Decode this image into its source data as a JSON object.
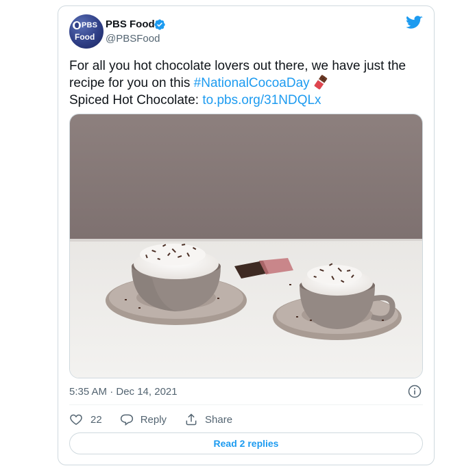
{
  "author": {
    "display_name": "PBS Food",
    "handle": "@PBSFood",
    "avatar_text_top": "PBS",
    "avatar_text_bottom": "Food",
    "verified": true
  },
  "tweet": {
    "text_part1": "For all you hot chocolate lovers out there, we have just the recipe for you on this ",
    "hashtag": "#NationalCocoaDay",
    "emoji_icon": "chocolate-bar-emoji",
    "line2_prefix": "Spiced Hot Chocolate: ",
    "link": "to.pbs.org/31NDQLx",
    "timestamp": "5:35 AM · Dec 14, 2021"
  },
  "media": {
    "icon": "photo-hot-chocolate-cups"
  },
  "actions": {
    "like_count": "22",
    "reply_label": "Reply",
    "share_label": "Share"
  },
  "footer": {
    "read_replies_label": "Read 2 replies"
  },
  "colors": {
    "accent": "#1d9bf0",
    "text_primary": "#0f1419",
    "text_secondary": "#536471",
    "border": "#cfd9de"
  }
}
